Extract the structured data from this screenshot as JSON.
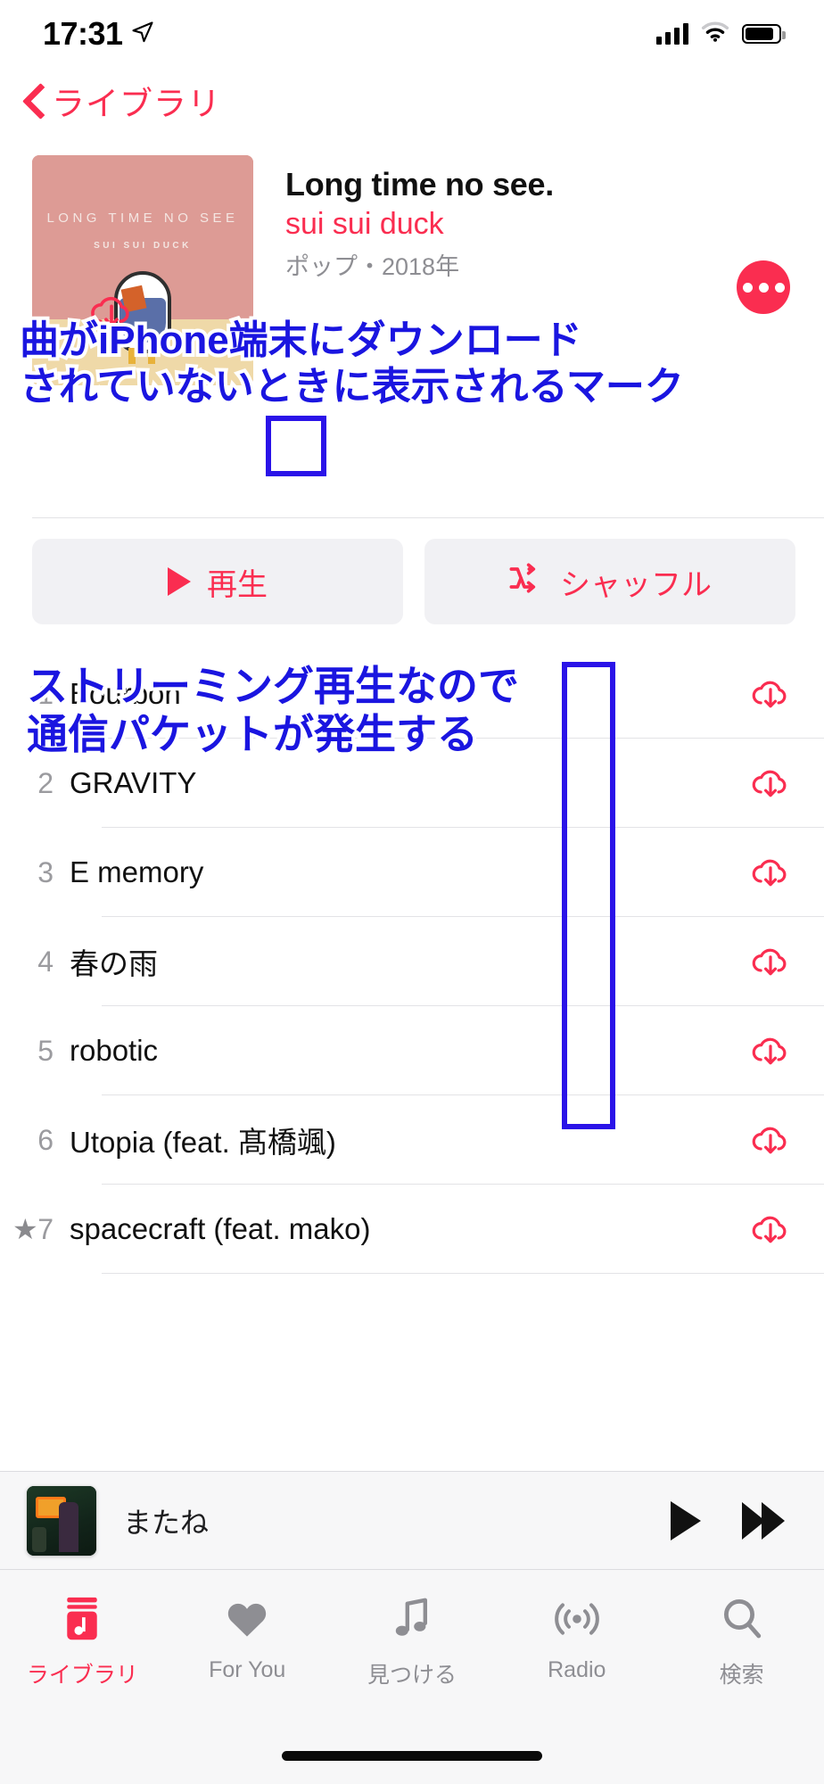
{
  "status_bar": {
    "time": "17:31",
    "location_icon": "location-arrow-icon",
    "signal_icon": "cellular-signal-icon",
    "wifi_icon": "wifi-icon",
    "battery_icon": "battery-icon"
  },
  "nav": {
    "back_label": "ライブラリ",
    "back_icon": "chevron-left-icon"
  },
  "album": {
    "cover_line1": "LONG TIME NO SEE",
    "cover_line2": "SUI SUI DUCK",
    "title": "Long time no see.",
    "artist": "sui sui duck",
    "subtitle": "ポップ・2018年",
    "download_icon": "cloud-download-icon",
    "more_icon": "more-ellipsis-icon"
  },
  "actions": {
    "play_label": "再生",
    "play_icon": "play-icon",
    "shuffle_label": "シャッフル",
    "shuffle_icon": "shuffle-icon"
  },
  "tracks": [
    {
      "num": "1",
      "name": "Bourbon",
      "star": "",
      "download_icon": "cloud-download-icon"
    },
    {
      "num": "2",
      "name": "GRAVITY",
      "star": "",
      "download_icon": "cloud-download-icon"
    },
    {
      "num": "3",
      "name": "E memory",
      "star": "",
      "download_icon": "cloud-download-icon"
    },
    {
      "num": "4",
      "name": "春の雨",
      "star": "",
      "download_icon": "cloud-download-icon"
    },
    {
      "num": "5",
      "name": "robotic",
      "star": "",
      "download_icon": "cloud-download-icon"
    },
    {
      "num": "6",
      "name": "Utopia (feat. 髙橋颯)",
      "star": "",
      "download_icon": "cloud-download-icon"
    },
    {
      "num": "7",
      "name": "spacecraft (feat. mako)",
      "star": "★",
      "download_icon": "cloud-download-icon"
    }
  ],
  "annotations": [
    {
      "id": "a",
      "line1": "曲がiPhone端末にダウンロード",
      "line2": "されていないときに表示されるマーク",
      "color": "#1a15e0"
    },
    {
      "id": "b",
      "line1": "ストリーミング再生なので",
      "line2": "通信パケットが発生する",
      "color": "#1a15e0"
    }
  ],
  "highlight_boxes": {
    "color": "#2a13e8"
  },
  "mini_player": {
    "title": "またね",
    "artwork_icon": "album-artwork",
    "play_icon": "play-icon",
    "forward_icon": "fast-forward-icon"
  },
  "tab_bar": {
    "accent_color": "#fa2d50",
    "inactive_color": "#8e8e93",
    "items": [
      {
        "label": "ライブラリ",
        "icon": "library-icon",
        "active": true
      },
      {
        "label": "For You",
        "icon": "heart-icon",
        "active": false
      },
      {
        "label": "見つける",
        "icon": "music-note-icon",
        "active": false
      },
      {
        "label": "Radio",
        "icon": "radio-icon",
        "active": false
      },
      {
        "label": "検索",
        "icon": "search-icon",
        "active": false
      }
    ]
  }
}
